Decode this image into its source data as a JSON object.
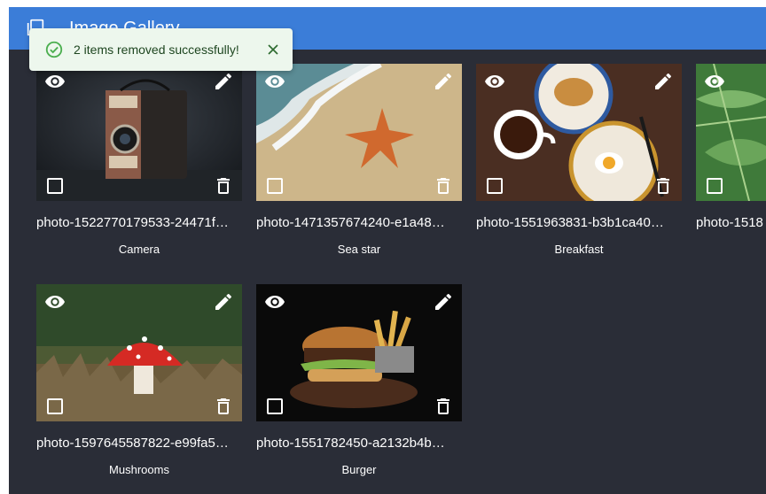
{
  "app": {
    "title": "Image Gallery",
    "brand_color": "#3b7dd8",
    "background_color": "#2a2d37"
  },
  "toast": {
    "message": "2 items removed successfully!",
    "status_color": "#2e7d32",
    "icon": "check-circle-icon",
    "close_icon": "close-icon"
  },
  "gallery": {
    "items": [
      {
        "filename": "photo-1522770179533-24471f…",
        "caption": "Camera"
      },
      {
        "filename": "photo-1471357674240-e1a48…",
        "caption": "Sea star"
      },
      {
        "filename": "photo-1551963831-b3b1ca40…",
        "caption": "Breakfast"
      },
      {
        "filename": "photo-1518",
        "caption": ""
      },
      {
        "filename": "photo-1597645587822-e99fa5…",
        "caption": "Mushrooms"
      },
      {
        "filename": "photo-1551782450-a2132b4b…",
        "caption": "Burger"
      }
    ],
    "overlay_icons": [
      "eye-icon",
      "pencil-icon",
      "checkbox-icon",
      "trash-icon"
    ]
  }
}
